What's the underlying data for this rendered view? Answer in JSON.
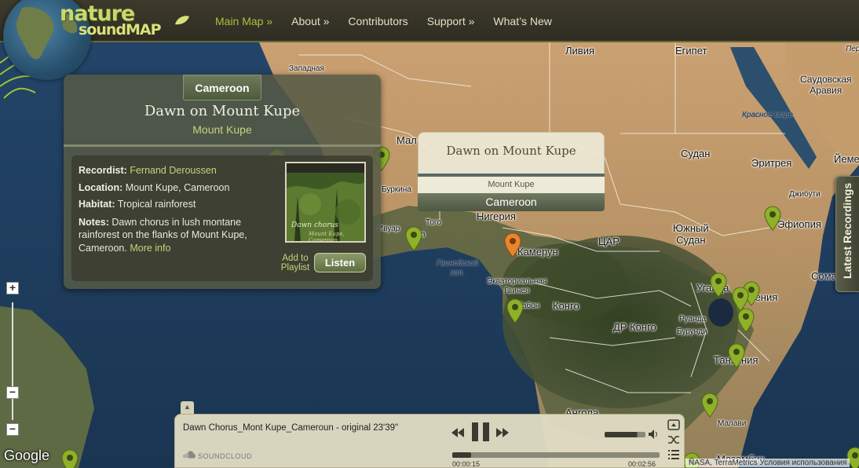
{
  "header": {
    "logo": {
      "word1": "nature",
      "word2": "soundMAP"
    },
    "nav": [
      {
        "label": "Main Map »",
        "active": true
      },
      {
        "label": "About »",
        "active": false
      },
      {
        "label": "Contributors",
        "active": false
      },
      {
        "label": "Support »",
        "active": false
      },
      {
        "label": "What’s New",
        "active": false
      }
    ]
  },
  "map": {
    "labels": {
      "libya": "Ливия",
      "egypt": "Египет",
      "western_sahara": "Западная",
      "saudi_arabia": "Саудовская\nАравия",
      "red_sea": "Красное море",
      "sudan": "Судан",
      "eritrea": "Эритрея",
      "yemen": "Йеме",
      "djibouti": "Джибути",
      "mali": "Мал",
      "burkina": "Буркина",
      "ghana": "Гана",
      "togo": "Того",
      "nigeria": "Нигерия",
      "ivory_coast": "Ивуар",
      "gulf_guinea": "Гвинейский\nзал.",
      "cameroon": "Камерун",
      "car": "ЦАР",
      "south_sudan": "Южный\nСудан",
      "ethiopia": "Эфиопия",
      "somalia": "Сома",
      "eq_guinea": "Экваториальная\nГвинея",
      "gabon": "Габон",
      "congo": "Конго",
      "drc": "ДР Конго",
      "uganda": "Уганда",
      "kenya": "Кения",
      "rwanda": "Руанда",
      "burundi": "Бурунди",
      "tanzania": "Танзания",
      "angola": "Ангола",
      "malawi": "Малави",
      "mozambique": "Мозамбик",
      "persian": "Перс"
    }
  },
  "info_card": {
    "country": "Cameroon",
    "title": "Dawn on Mount Kupe",
    "subtitle": "Mount Kupe",
    "recordist_label": "Recordist:",
    "recordist": "Fernand Deroussen",
    "location_label": "Location:",
    "location": "Mount Kupe, Cameroon",
    "habitat_label": "Habitat:",
    "habitat": "Tropical rainforest",
    "notes_label": "Notes:",
    "notes": "Dawn chorus in lush montane rainforest on the flanks of Mount Kupe, Cameroon.",
    "more_info": "More info",
    "cover_title": "Dawn chorus",
    "cover_subtitle": "Mount Kupe, Cameroun",
    "add_playlist": "Add to Playlist",
    "listen": "Listen"
  },
  "tooltip": {
    "title": "Dawn on Mount Kupe",
    "subtitle": "Mount Kupe",
    "country": "Cameroon"
  },
  "side_tab": {
    "label": "Latest Recordings"
  },
  "zoom": {
    "in": "+",
    "out": "−"
  },
  "attribution": {
    "google": "Google",
    "credits": "NASA, TerraMetrics  Условия использования"
  },
  "player": {
    "track": "Dawn Chorus_Mont Kupe_Cameroun - original 23'39\"",
    "source": "SOUNDCLOUD",
    "time_current": "00:00:15",
    "time_total": "00:02:56",
    "progress": 0.09,
    "volume": 0.8
  },
  "colors": {
    "pin": "#8fb12a",
    "pin_active": "#e8862c",
    "accent": "#a7c43e"
  }
}
